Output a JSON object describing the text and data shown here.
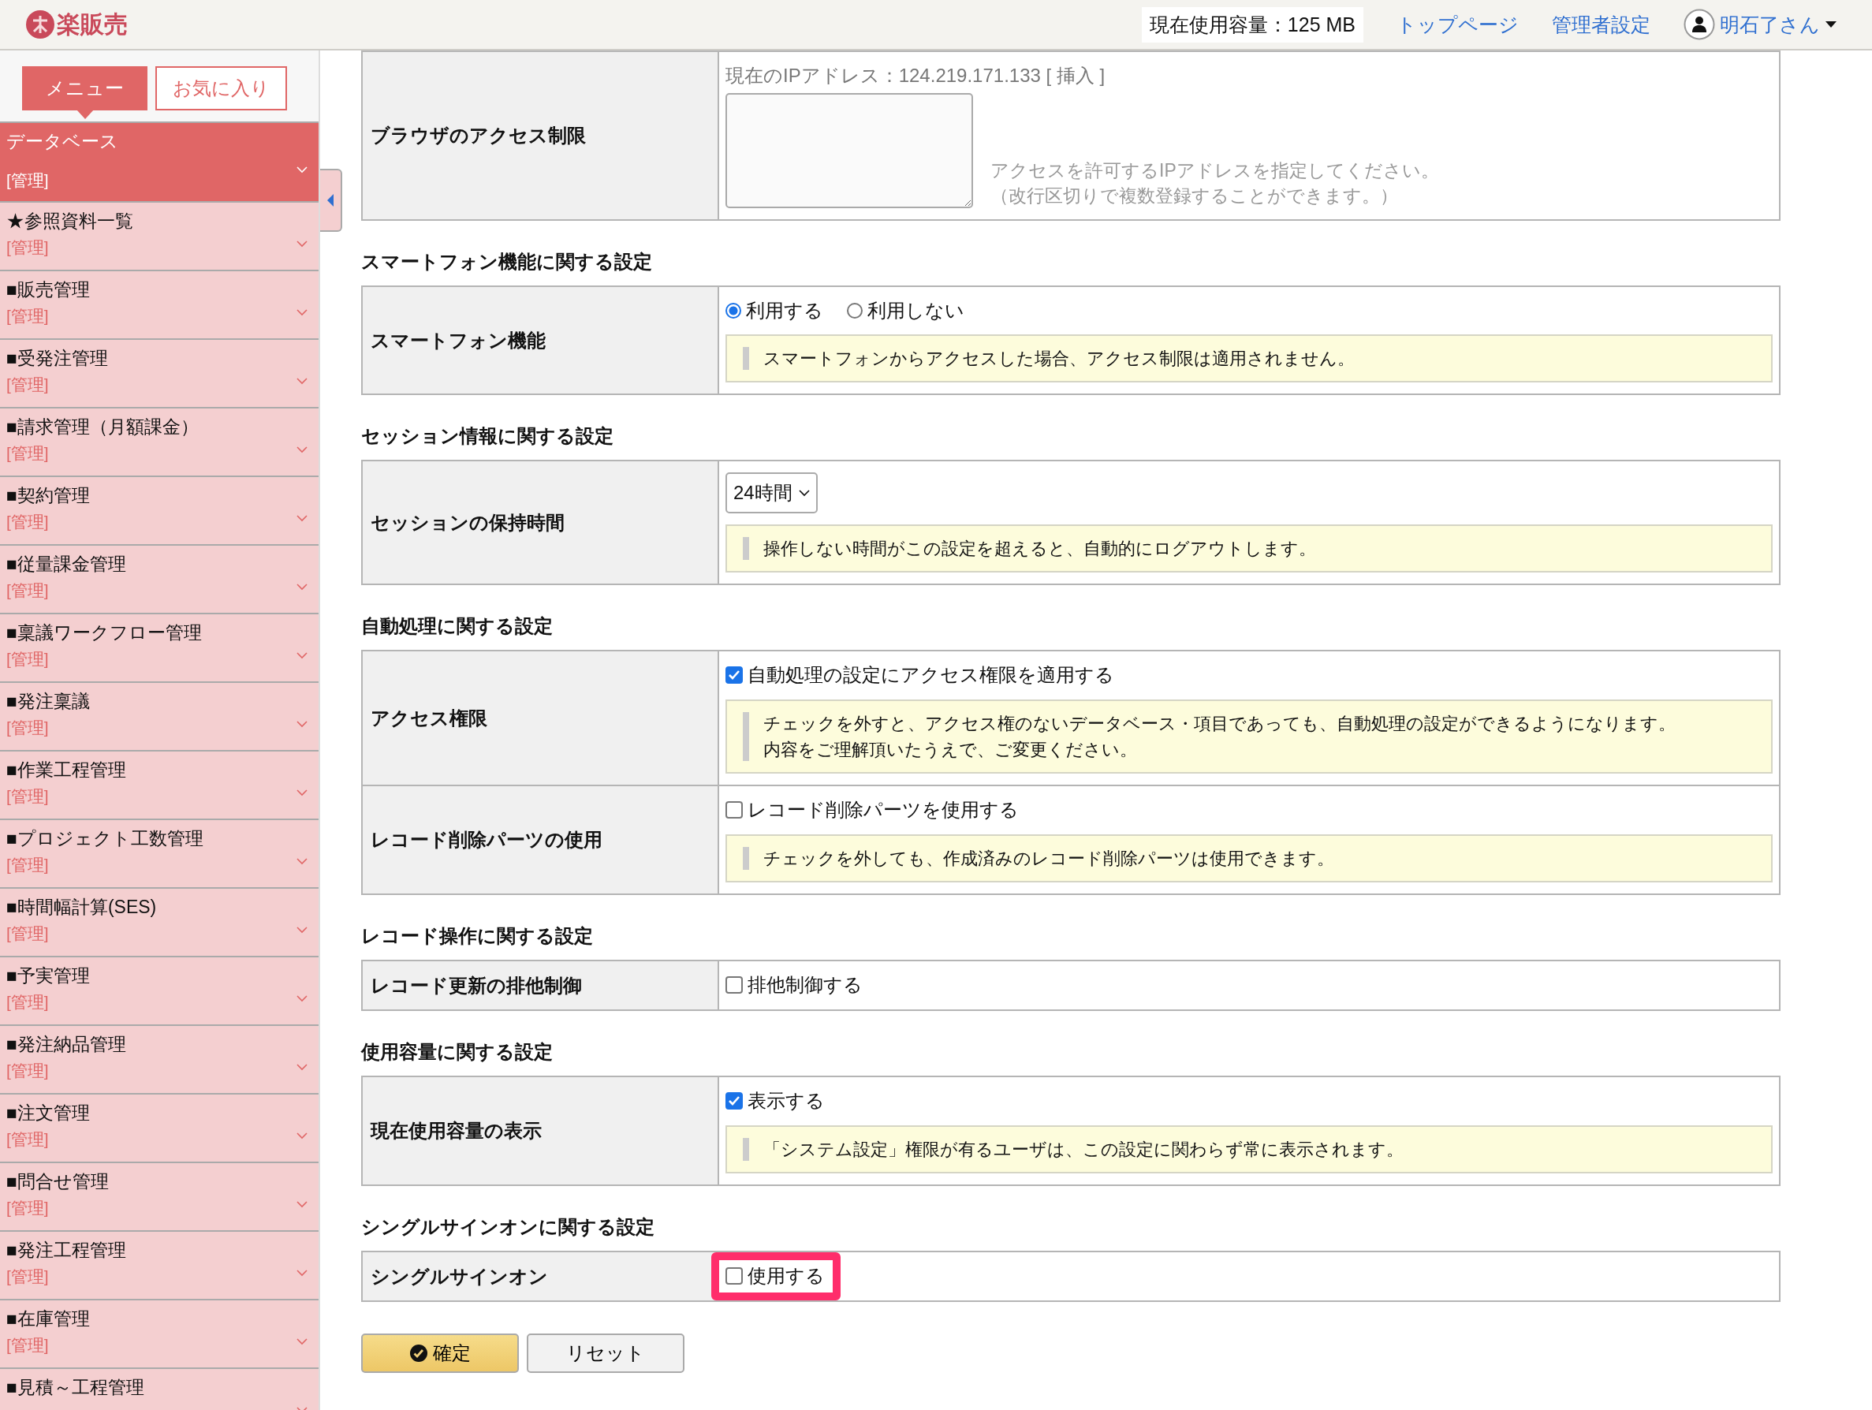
{
  "header": {
    "logo": "楽販売",
    "usage": "現在使用容量：125 MB",
    "links": [
      "トップページ",
      "管理者設定"
    ],
    "user": "明石了さん"
  },
  "sidebar": {
    "tabs": [
      {
        "label": "メニュー",
        "selected": true
      },
      {
        "label": "お気に入り",
        "selected": false
      }
    ],
    "items": [
      {
        "title": "データベース",
        "sub": "[管理]",
        "selected": true
      },
      {
        "title": "★参照資料一覧",
        "sub": "[管理]",
        "selected": false
      },
      {
        "title": "■販売管理",
        "sub": "[管理]",
        "selected": false
      },
      {
        "title": "■受発注管理",
        "sub": "[管理]",
        "selected": false
      },
      {
        "title": "■請求管理（月額課金）",
        "sub": "[管理]",
        "selected": false
      },
      {
        "title": "■契約管理",
        "sub": "[管理]",
        "selected": false
      },
      {
        "title": "■従量課金管理",
        "sub": "[管理]",
        "selected": false
      },
      {
        "title": "■稟議ワークフロー管理",
        "sub": "[管理]",
        "selected": false
      },
      {
        "title": "■発注稟議",
        "sub": "[管理]",
        "selected": false
      },
      {
        "title": "■作業工程管理",
        "sub": "[管理]",
        "selected": false
      },
      {
        "title": "■プロジェクト工数管理",
        "sub": "[管理]",
        "selected": false
      },
      {
        "title": "■時間幅計算(SES)",
        "sub": "[管理]",
        "selected": false
      },
      {
        "title": "■予実管理",
        "sub": "[管理]",
        "selected": false
      },
      {
        "title": "■発注納品管理",
        "sub": "[管理]",
        "selected": false
      },
      {
        "title": "■注文管理",
        "sub": "[管理]",
        "selected": false
      },
      {
        "title": "■問合せ管理",
        "sub": "[管理]",
        "selected": false
      },
      {
        "title": "■発注工程管理",
        "sub": "[管理]",
        "selected": false
      },
      {
        "title": "■在庫管理",
        "sub": "[管理]",
        "selected": false
      },
      {
        "title": "■見積～工程管理",
        "selected": false
      }
    ]
  },
  "sections": [
    {
      "rows": [
        {
          "label": "ブラウザのアクセス制限",
          "parts": [
            {
              "kind": "text",
              "text": "現在のIPアドレス：124.219.171.133 [ 挿入 ]"
            },
            {
              "kind": "textarea",
              "hint": [
                "アクセスを許可するIPアドレスを指定してください。",
                "（改行区切りで複数登録することができます。）"
              ]
            }
          ]
        }
      ]
    },
    {
      "heading": "スマートフォン機能に関する設定",
      "rows": [
        {
          "label": "スマートフォン機能",
          "parts": [
            {
              "kind": "radios",
              "options": [
                {
                  "label": "利用する",
                  "selected": true
                },
                {
                  "label": "利用しない",
                  "selected": false
                }
              ]
            },
            {
              "kind": "note",
              "lines": [
                "スマートフォンからアクセスした場合、アクセス制限は適用されません。"
              ]
            }
          ]
        }
      ]
    },
    {
      "heading": "セッション情報に関する設定",
      "rows": [
        {
          "label": "セッションの保持時間",
          "parts": [
            {
              "kind": "select",
              "value": "24時間"
            },
            {
              "kind": "note",
              "lines": [
                "操作しない時間がこの設定を超えると、自動的にログアウトします。"
              ]
            }
          ]
        }
      ]
    },
    {
      "heading": "自動処理に関する設定",
      "rows": [
        {
          "label": "アクセス権限",
          "parts": [
            {
              "kind": "checkbox",
              "label": "自動処理の設定にアクセス権限を適用する",
              "checked": true,
              "highlighted": false
            },
            {
              "kind": "note",
              "lines": [
                "チェックを外すと、アクセス権のないデータベース・項目であっても、自動処理の設定ができるようになります。",
                "内容をご理解頂いたうえで、ご変更ください。"
              ]
            }
          ]
        },
        {
          "label": "レコード削除パーツの使用",
          "parts": [
            {
              "kind": "checkbox",
              "label": "レコード削除パーツを使用する",
              "checked": false,
              "highlighted": false
            },
            {
              "kind": "note",
              "lines": [
                "チェックを外しても、作成済みのレコード削除パーツは使用できます。"
              ]
            }
          ]
        }
      ]
    },
    {
      "heading": "レコード操作に関する設定",
      "rows": [
        {
          "label": "レコード更新の排他制御",
          "parts": [
            {
              "kind": "checkbox",
              "label": "排他制御する",
              "checked": false,
              "highlighted": false
            }
          ]
        }
      ]
    },
    {
      "heading": "使用容量に関する設定",
      "rows": [
        {
          "label": "現在使用容量の表示",
          "parts": [
            {
              "kind": "checkbox",
              "label": "表示する",
              "checked": true,
              "highlighted": false
            },
            {
              "kind": "note",
              "lines": [
                "「システム設定」権限が有るユーザは、この設定に関わらず常に表示されます。"
              ]
            }
          ]
        }
      ]
    },
    {
      "heading": "シングルサインオンに関する設定",
      "rows": [
        {
          "label": "シングルサインオン",
          "parts": [
            {
              "kind": "checkbox",
              "label": "使用する",
              "checked": false,
              "highlighted": true
            }
          ]
        }
      ]
    }
  ],
  "buttons": [
    {
      "label": "確定",
      "kind": "primary"
    },
    {
      "label": "リセット",
      "kind": "secondary"
    }
  ]
}
